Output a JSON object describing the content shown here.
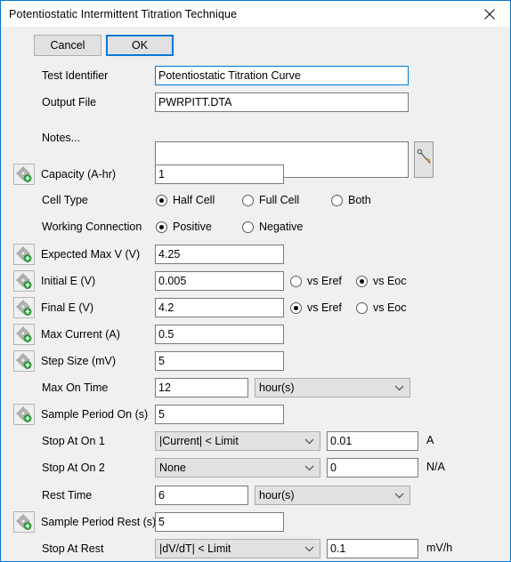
{
  "window": {
    "title": "Potentiostatic Intermittent Titration Technique",
    "close_icon": "close-icon",
    "accent_color": "#0078d7",
    "client_bg": "#f0f0f0"
  },
  "toolbar": {
    "cancel_label": "Cancel",
    "ok_label": "OK"
  },
  "fields": {
    "test_identifier": {
      "label": "Test Identifier",
      "value": "Potentiostatic Titration Curve",
      "placeholder": ""
    },
    "output_file": {
      "label": "Output File",
      "value": "PWRPITT.DTA",
      "placeholder": ""
    },
    "notes": {
      "label": "Notes...",
      "value": "",
      "placeholder": "",
      "edit_icon": "pencil-icon"
    },
    "capacity": {
      "label": "Capacity (A-hr)",
      "value": "1",
      "gear_icon": "gear-plus-icon"
    },
    "cell_type": {
      "label": "Cell Type",
      "options": [
        "Half Cell",
        "Full Cell",
        "Both"
      ],
      "selected": "Half Cell"
    },
    "working_connection": {
      "label": "Working Connection",
      "options": [
        "Positive",
        "Negative"
      ],
      "selected": "Positive"
    },
    "expected_max_v": {
      "label": "Expected Max V (V)",
      "value": "4.25",
      "gear_icon": "gear-plus-icon"
    },
    "initial_e": {
      "label": "Initial E (V)",
      "value": "0.005",
      "gear_icon": "gear-plus-icon",
      "ref_options": [
        "vs Eref",
        "vs Eoc"
      ],
      "ref_selected": "vs Eoc"
    },
    "final_e": {
      "label": "Final E (V)",
      "value": "4.2",
      "gear_icon": "gear-plus-icon",
      "ref_options": [
        "vs Eref",
        "vs Eoc"
      ],
      "ref_selected": "vs Eref"
    },
    "max_current": {
      "label": "Max Current (A)",
      "value": "0.5",
      "gear_icon": "gear-plus-icon"
    },
    "step_size": {
      "label": "Step Size (mV)",
      "value": "5",
      "gear_icon": "gear-plus-icon"
    },
    "max_on_time": {
      "label": "Max On Time",
      "value": "12",
      "unit_selected": "hour(s)",
      "unit_options": [
        "hour(s)"
      ]
    },
    "sample_period_on": {
      "label": "Sample Period On (s)",
      "value": "5",
      "gear_icon": "gear-plus-icon"
    },
    "stop_at_on_1": {
      "label": "Stop At On 1",
      "condition_selected": "|Current| < Limit",
      "condition_options": [
        "|Current| < Limit"
      ],
      "value": "0.01",
      "unit": "A"
    },
    "stop_at_on_2": {
      "label": "Stop At On 2",
      "condition_selected": "None",
      "condition_options": [
        "None"
      ],
      "value": "0",
      "unit": "N/A"
    },
    "rest_time": {
      "label": "Rest Time",
      "value": "6",
      "unit_selected": "hour(s)",
      "unit_options": [
        "hour(s)"
      ]
    },
    "sample_period_rest": {
      "label": "Sample Period Rest (s)",
      "value": "5",
      "gear_icon": "gear-plus-icon"
    },
    "stop_at_rest": {
      "label": "Stop At Rest",
      "condition_selected": "|dV/dT| < Limit",
      "condition_options": [
        "|dV/dT| < Limit"
      ],
      "value": "0.1",
      "unit": "mV/h"
    }
  }
}
